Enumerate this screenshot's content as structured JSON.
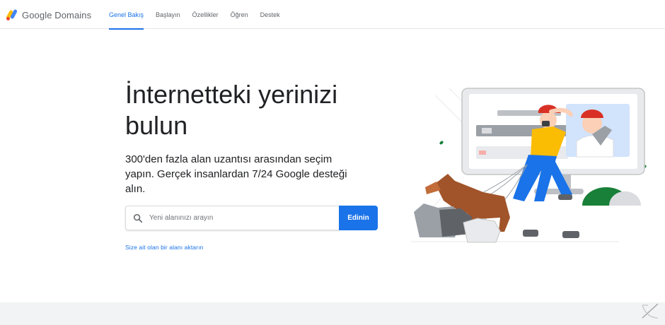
{
  "header": {
    "logo_text": "Google Domains",
    "nav": [
      {
        "label": "Genel Bakış",
        "active": true
      },
      {
        "label": "Başlayın",
        "active": false
      },
      {
        "label": "Özellikler",
        "active": false
      },
      {
        "label": "Öğren",
        "active": false
      },
      {
        "label": "Destek",
        "active": false
      }
    ]
  },
  "hero": {
    "headline_line1": "İnternetteki yerinizi",
    "headline_line2": "bulun",
    "subhead": "300'den fazla alan uzantısı arasından seçim yapın. Gerçek insanlardan 7/24 Google desteği alın.",
    "search": {
      "icon": "search-icon",
      "placeholder": "Yeni alanınızı arayın",
      "value": ""
    },
    "cta_label": "Edinin",
    "transfer_link": "Size ait olan bir alanı aktarın"
  },
  "colors": {
    "accent": "#1a73e8",
    "logo_yellow": "#fbbc04",
    "logo_blue": "#4285f4",
    "footer_band": "#f1f3f4"
  }
}
